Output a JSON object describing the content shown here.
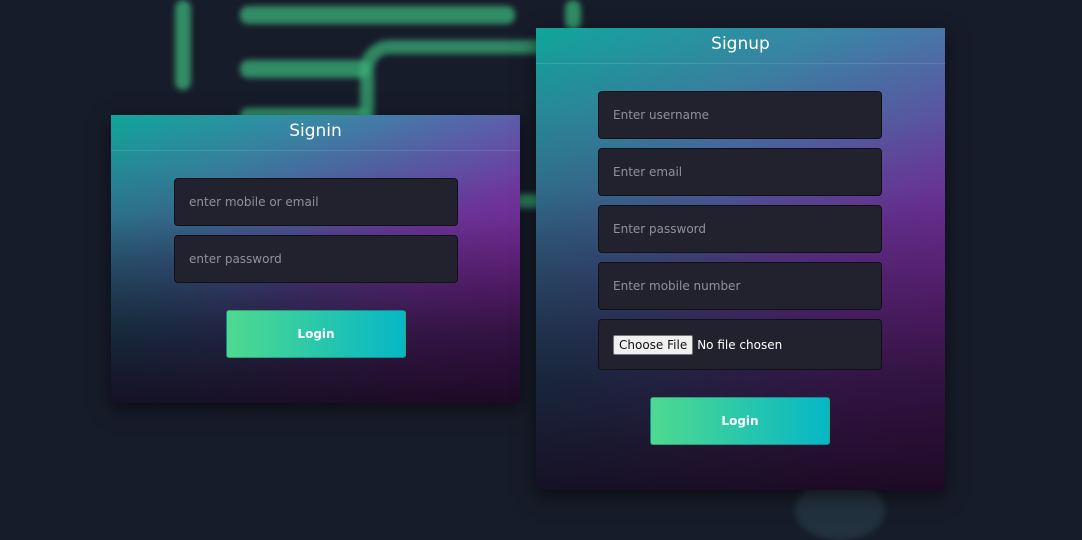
{
  "signin": {
    "title": "Signin",
    "mobile_or_email_placeholder": "enter mobile or email",
    "password_placeholder": "enter password",
    "login_label": "Login"
  },
  "signup": {
    "title": "Signup",
    "username_placeholder": "Enter username",
    "email_placeholder": "Enter email",
    "password_placeholder": "Enter password",
    "mobile_placeholder": "Enter mobile number",
    "choose_file_label": "Choose File",
    "file_status": "No file chosen",
    "login_label": "Login"
  },
  "colors": {
    "page_background": "#171c2a",
    "button_gradient_start": "#4fd98f",
    "button_gradient_end": "#06b7c6",
    "field_background": "#22222f",
    "card_accent_teal": "#0fa69a",
    "card_accent_magenta": "#b21fb8"
  }
}
